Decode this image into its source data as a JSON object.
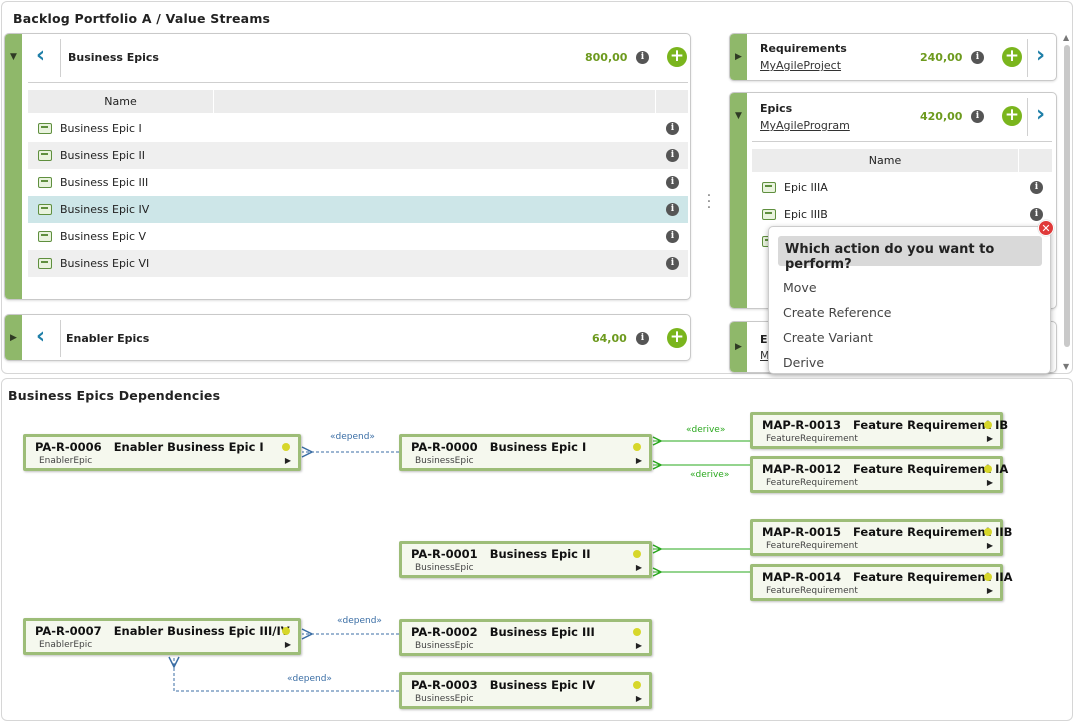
{
  "top_panel": {
    "title": "Backlog Portfolio A / Value Streams"
  },
  "business_epics": {
    "title": "Business Epics",
    "value": "800,00",
    "column_header": "Name",
    "rows": [
      "Business Epic I",
      "Business Epic II",
      "Business Epic III",
      "Business Epic IV",
      "Business Epic V",
      "Business Epic VI"
    ],
    "selected_index": 3
  },
  "enabler_epics": {
    "title": "Enabler Epics",
    "value": "64,00"
  },
  "requirements": {
    "title": "Requirements",
    "link": "MyAgileProject",
    "value": "240,00"
  },
  "epics": {
    "title": "Epics",
    "link": "MyAgileProgram",
    "value": "420,00",
    "column_header": "Name",
    "rows": [
      "Epic IIIA",
      "Epic IIIB"
    ]
  },
  "partial_card": {
    "title": "E",
    "link": "M"
  },
  "action_popup": {
    "title": "Which action do you want to perform?",
    "items": [
      "Move",
      "Create Reference",
      "Create Variant",
      "Derive"
    ]
  },
  "icons": {
    "collapse": "triangle-down-icon",
    "expand": "triangle-right-icon",
    "info": "info-icon",
    "add": "plus-circle-icon",
    "back": "chevron-left-icon",
    "forward": "chevron-right-icon",
    "item": "epic-card-icon",
    "close": "close-icon",
    "more": "vertical-dots-icon"
  },
  "colors": {
    "accent_green": "#7ab51d",
    "strip_green": "#8fb86a",
    "value_green": "#6d9a1e",
    "chevron_blue": "#1f7fa8",
    "selected_row": "#cde6e8",
    "derive_edge": "#2aa81e",
    "depend_edge": "#3b6ea5",
    "close_red": "#e03a3a"
  },
  "dependencies": {
    "title": "Business Epics Dependencies",
    "nodes": [
      {
        "id": "PA-R-0006",
        "name": "Enabler Business Epic I",
        "type": "EnablerEpic"
      },
      {
        "id": "PA-R-0000",
        "name": "Business Epic I",
        "type": "BusinessEpic"
      },
      {
        "id": "MAP-R-0013",
        "name": "Feature Requirement IB",
        "type": "FeatureRequirement"
      },
      {
        "id": "MAP-R-0012",
        "name": "Feature Requirement IA",
        "type": "FeatureRequirement"
      },
      {
        "id": "PA-R-0001",
        "name": "Business Epic II",
        "type": "BusinessEpic"
      },
      {
        "id": "MAP-R-0015",
        "name": "Feature Requirement IIB",
        "type": "FeatureRequirement"
      },
      {
        "id": "MAP-R-0014",
        "name": "Feature Requirement IIA",
        "type": "FeatureRequirement"
      },
      {
        "id": "PA-R-0007",
        "name": "Enabler Business Epic III/IV",
        "type": "EnablerEpic"
      },
      {
        "id": "PA-R-0002",
        "name": "Business Epic III",
        "type": "BusinessEpic"
      },
      {
        "id": "PA-R-0003",
        "name": "Business Epic IV",
        "type": "BusinessEpic"
      }
    ],
    "edges": [
      {
        "from": "PA-R-0000",
        "to": "PA-R-0006",
        "label": "«depend»",
        "kind": "depend"
      },
      {
        "from": "MAP-R-0013",
        "to": "PA-R-0000",
        "label": "«derive»",
        "kind": "derive"
      },
      {
        "from": "MAP-R-0012",
        "to": "PA-R-0000",
        "label": "«derive»",
        "kind": "derive"
      },
      {
        "from": "MAP-R-0015",
        "to": "PA-R-0001",
        "label": "",
        "kind": "derive"
      },
      {
        "from": "MAP-R-0014",
        "to": "PA-R-0001",
        "label": "",
        "kind": "derive"
      },
      {
        "from": "PA-R-0002",
        "to": "PA-R-0007",
        "label": "«depend»",
        "kind": "depend"
      },
      {
        "from": "PA-R-0003",
        "to": "PA-R-0007",
        "label": "«depend»",
        "kind": "depend"
      }
    ]
  }
}
